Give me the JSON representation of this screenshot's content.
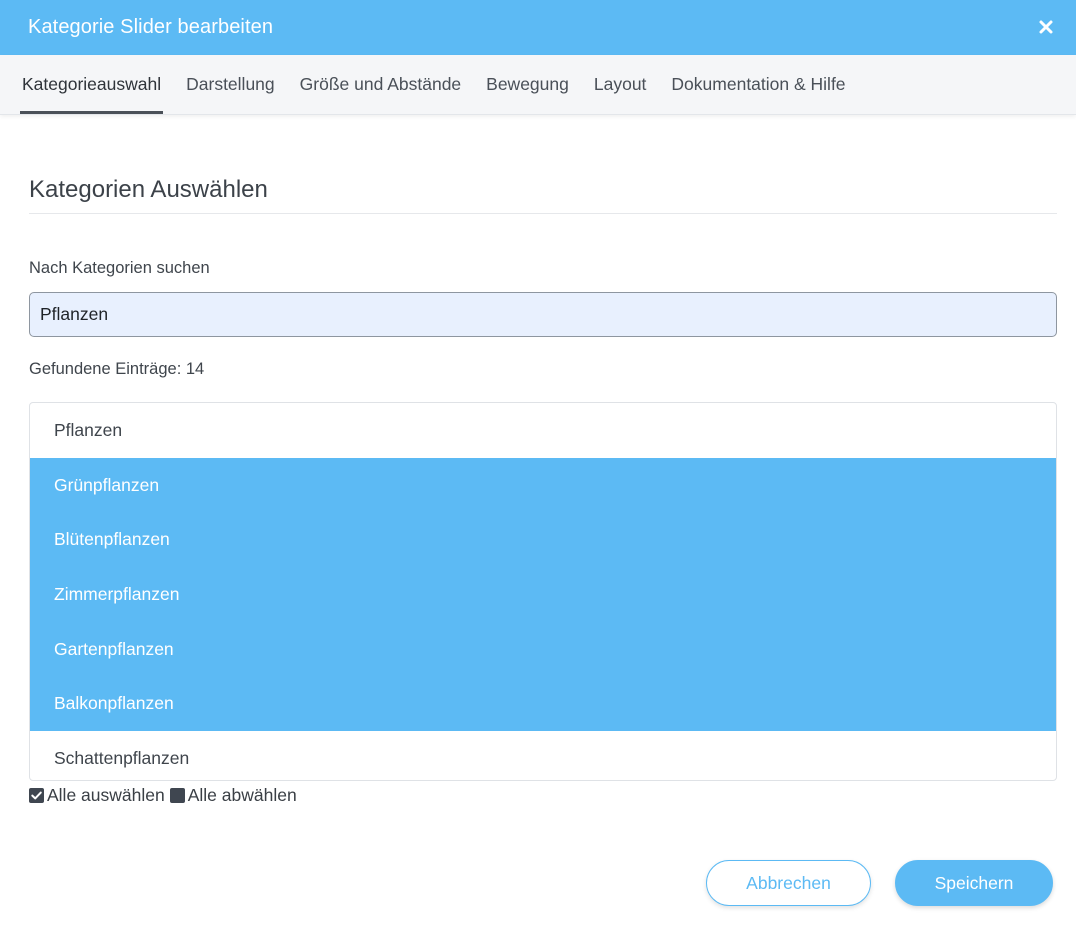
{
  "colors": {
    "accent": "#5cbaf4",
    "header_text": "#ffffff",
    "tab_active_underline": "#4a5058",
    "input_background": "#e8f0fe"
  },
  "header": {
    "title": "Kategorie Slider bearbeiten",
    "close_icon": "close-icon"
  },
  "tabs": [
    {
      "label": "Kategorieauswahl",
      "active": true
    },
    {
      "label": "Darstellung",
      "active": false
    },
    {
      "label": "Größe und Abstände",
      "active": false
    },
    {
      "label": "Bewegung",
      "active": false
    },
    {
      "label": "Layout",
      "active": false
    },
    {
      "label": "Dokumentation & Hilfe",
      "active": false
    }
  ],
  "section": {
    "title": "Kategorien Auswählen"
  },
  "search": {
    "label": "Nach Kategorien suchen",
    "value": "Pflanzen",
    "placeholder": ""
  },
  "results": {
    "count_text": "Gefundene Einträge: 14",
    "items": [
      {
        "label": "Pflanzen",
        "selected": false
      },
      {
        "label": "Grünpflanzen",
        "selected": true
      },
      {
        "label": "Blütenpflanzen",
        "selected": true
      },
      {
        "label": "Zimmerpflanzen",
        "selected": true
      },
      {
        "label": "Gartenpflanzen",
        "selected": true
      },
      {
        "label": "Balkonpflanzen",
        "selected": true
      },
      {
        "label": "Schattenpflanzen",
        "selected": false
      }
    ]
  },
  "selection": {
    "select_all_label": "Alle auswählen",
    "select_all_icon": "checked-checkbox-icon",
    "deselect_all_label": "Alle abwählen",
    "deselect_all_icon": "filled-square-icon"
  },
  "footer": {
    "cancel_label": "Abbrechen",
    "save_label": "Speichern"
  }
}
